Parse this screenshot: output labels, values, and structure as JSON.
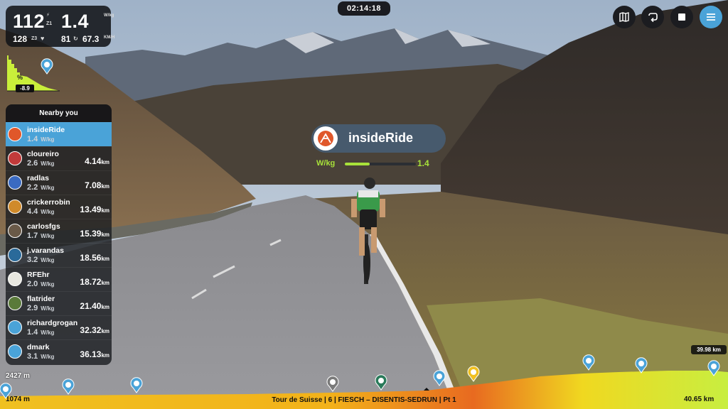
{
  "stats": {
    "power": "112",
    "power_zone": "Z1",
    "wkg": "1.4",
    "wkg_unit": "W/kg",
    "heart_rate": "128",
    "hr_zone": "Z3",
    "cadence": "81",
    "speed": "67.3",
    "speed_unit": "KM/H"
  },
  "timer": "02:14:18",
  "gradient": {
    "value": "-8.9",
    "symbol": "%"
  },
  "nearby": {
    "title": "Nearby you",
    "riders": [
      {
        "name": "insideRide",
        "wkg": "1.4",
        "dist": "",
        "active": true,
        "color": "#e0572a"
      },
      {
        "name": "cloureiro",
        "wkg": "2.6",
        "dist": "4.14",
        "active": false,
        "color": "#c23a3a"
      },
      {
        "name": "radlas",
        "wkg": "2.2",
        "dist": "7.08",
        "active": false,
        "color": "#3a6ac2"
      },
      {
        "name": "crickerrobin",
        "wkg": "4.4",
        "dist": "13.49",
        "active": false,
        "color": "#d08a2a"
      },
      {
        "name": "carlosfgs",
        "wkg": "1.7",
        "dist": "15.39",
        "active": false,
        "color": "#6a5a48"
      },
      {
        "name": "j.varandas",
        "wkg": "3.2",
        "dist": "18.56",
        "active": false,
        "color": "#2a6a9a"
      },
      {
        "name": "RFEhr",
        "wkg": "2.0",
        "dist": "18.72",
        "active": false,
        "color": "#e8e8e0"
      },
      {
        "name": "flatrider",
        "wkg": "2.9",
        "dist": "21.40",
        "active": false,
        "color": "#5a7a3a"
      },
      {
        "name": "richardgrogan",
        "wkg": "1.4",
        "dist": "32.32",
        "active": false,
        "color": "#4aa3d8"
      },
      {
        "name": "dmark",
        "wkg": "3.1",
        "dist": "36.13",
        "active": false,
        "color": "#4aa3d8"
      }
    ],
    "wkg_unit": "W/kg",
    "dist_unit": "km"
  },
  "rider_tag": {
    "name": "insideRide",
    "wkg_label": "W/kg",
    "wkg": "1.4",
    "wkg_fraction": 0.35
  },
  "route": {
    "max_elev": "2427 m",
    "min_elev": "1074 m",
    "title": "Tour de Suisse | 6 | FIESCH – DISENTIS-SEDRUN | Pt 1",
    "total_km": "40.65 km",
    "current_km": "39.98 km"
  },
  "icons": {
    "map": "map-icon",
    "loop": "loop-icon",
    "stop": "stop-icon",
    "menu": "menu-icon",
    "rider_pin": "rider-avatar-pin-icon"
  },
  "colors": {
    "accent": "#4aa3d8",
    "wkg_green": "#a8e23a"
  }
}
